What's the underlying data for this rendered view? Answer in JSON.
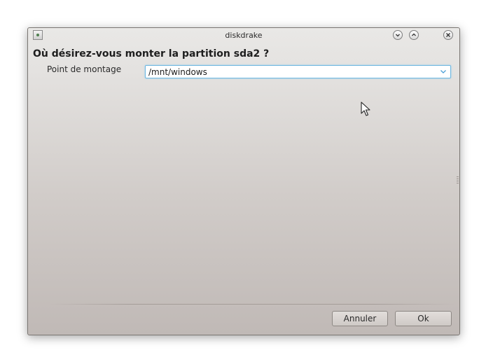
{
  "window": {
    "title": "diskdrake"
  },
  "dialog": {
    "heading": "Où désirez-vous monter la partition sda2 ?",
    "mount_point_label": "Point de montage",
    "mount_point_value": "/mnt/windows",
    "cancel_label": "Annuler",
    "ok_label": "Ok"
  },
  "icons": {
    "app": "diskdrake-app-icon",
    "minimize": "chevron-down-icon",
    "maximize": "chevron-up-icon",
    "close": "close-icon",
    "combo_arrow": "chevron-down-icon",
    "cursor": "mouse-pointer-icon"
  },
  "colors": {
    "focus_border": "#6fb7e0",
    "combo_arrow": "#4a9fd6"
  }
}
